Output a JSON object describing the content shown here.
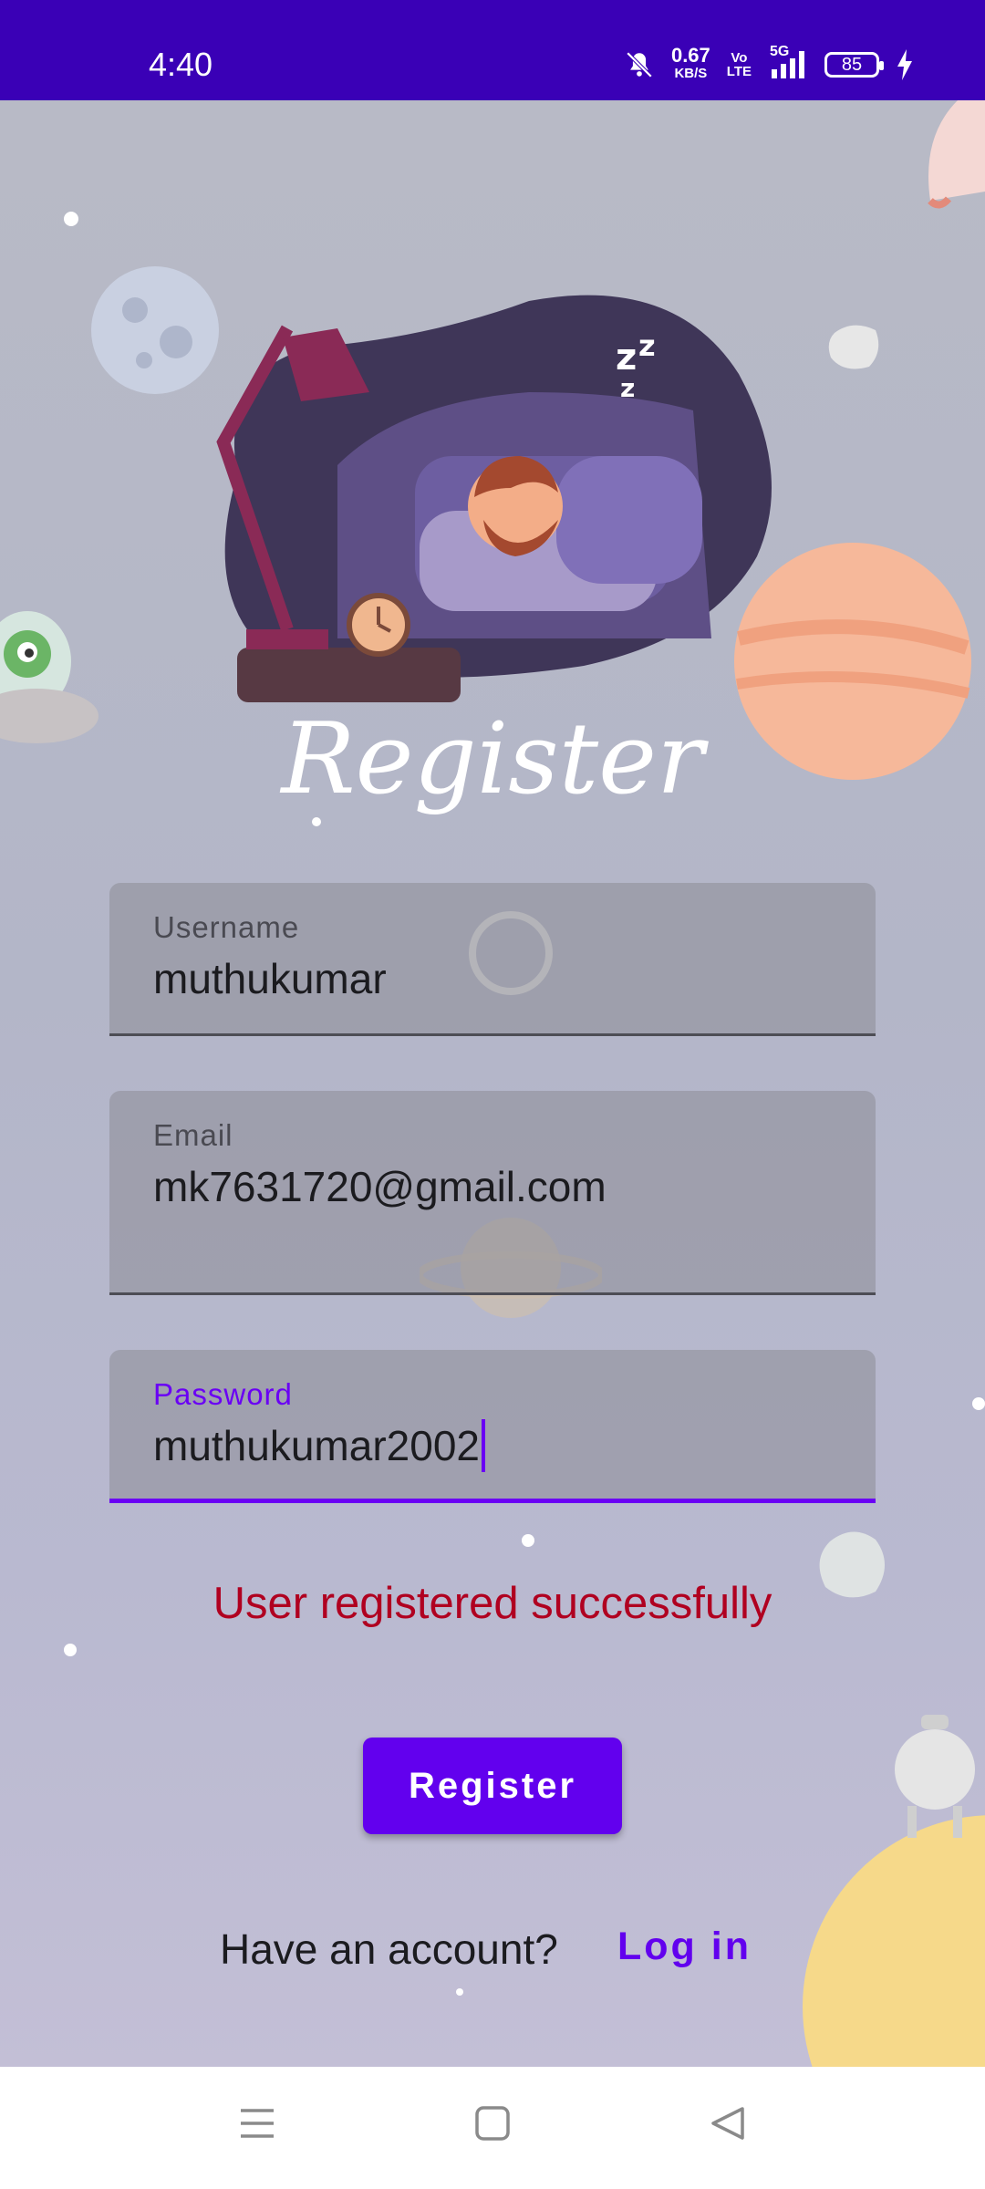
{
  "status_bar": {
    "time": "4:40",
    "net_speed": "0.67",
    "net_unit": "KB/S",
    "volte_top": "Vo",
    "volte_bottom": "LTE",
    "network": "5G",
    "battery": "85",
    "icons": [
      "mute-icon",
      "signal-icon",
      "battery-icon",
      "charging-icon"
    ]
  },
  "page": {
    "title": "Register",
    "illustration": "sleeping-man-illustration"
  },
  "form": {
    "username": {
      "label": "Username",
      "value": "muthukumar"
    },
    "email": {
      "label": "Email",
      "value": "mk7631720@gmail.com"
    },
    "password": {
      "label": "Password",
      "value": "muthukumar2002"
    }
  },
  "message": "User registered successfully",
  "register_button": "Register",
  "footer": {
    "prompt": "Have an account?",
    "login": "Log in"
  },
  "nav_bar": [
    "menu-icon",
    "home-icon",
    "back-icon"
  ],
  "colors": {
    "primary": "#6200ee",
    "status_bar": "#3a00b6",
    "error": "#b00020"
  }
}
